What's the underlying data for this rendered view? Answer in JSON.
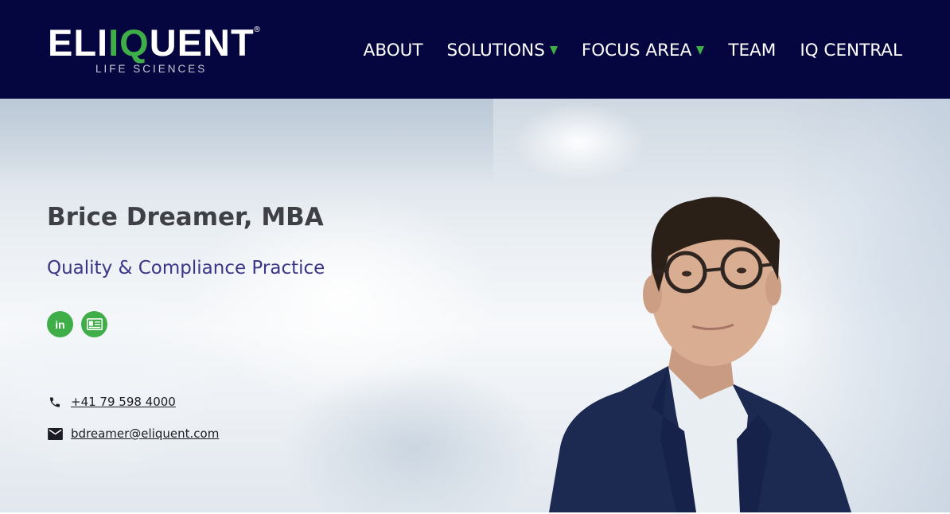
{
  "header": {
    "logo": {
      "word_part1": "ELI",
      "word_part2": "IQ",
      "word_part3": "UENT",
      "registered_mark": "®",
      "subtitle": "LIFE SCIENCES"
    },
    "nav": [
      {
        "label": "ABOUT",
        "has_dropdown": false
      },
      {
        "label": "SOLUTIONS",
        "has_dropdown": true
      },
      {
        "label": "FOCUS AREA",
        "has_dropdown": true
      },
      {
        "label": "TEAM",
        "has_dropdown": false
      },
      {
        "label": "IQ CENTRAL",
        "has_dropdown": false
      }
    ]
  },
  "profile": {
    "name": "Brice Dreamer, MBA",
    "practice": "Quality & Compliance Practice",
    "social": {
      "linkedin_label": "in",
      "linkedin_icon": "linkedin-icon",
      "vcard_icon": "vcard-icon"
    },
    "phone": "+41 79 598 4000",
    "email": "bdreamer@eliquent.com"
  },
  "colors": {
    "header_bg": "#05053f",
    "accent_green": "#3fae49",
    "practice_purple": "#3b3587",
    "name_gray": "#3f3f46"
  }
}
